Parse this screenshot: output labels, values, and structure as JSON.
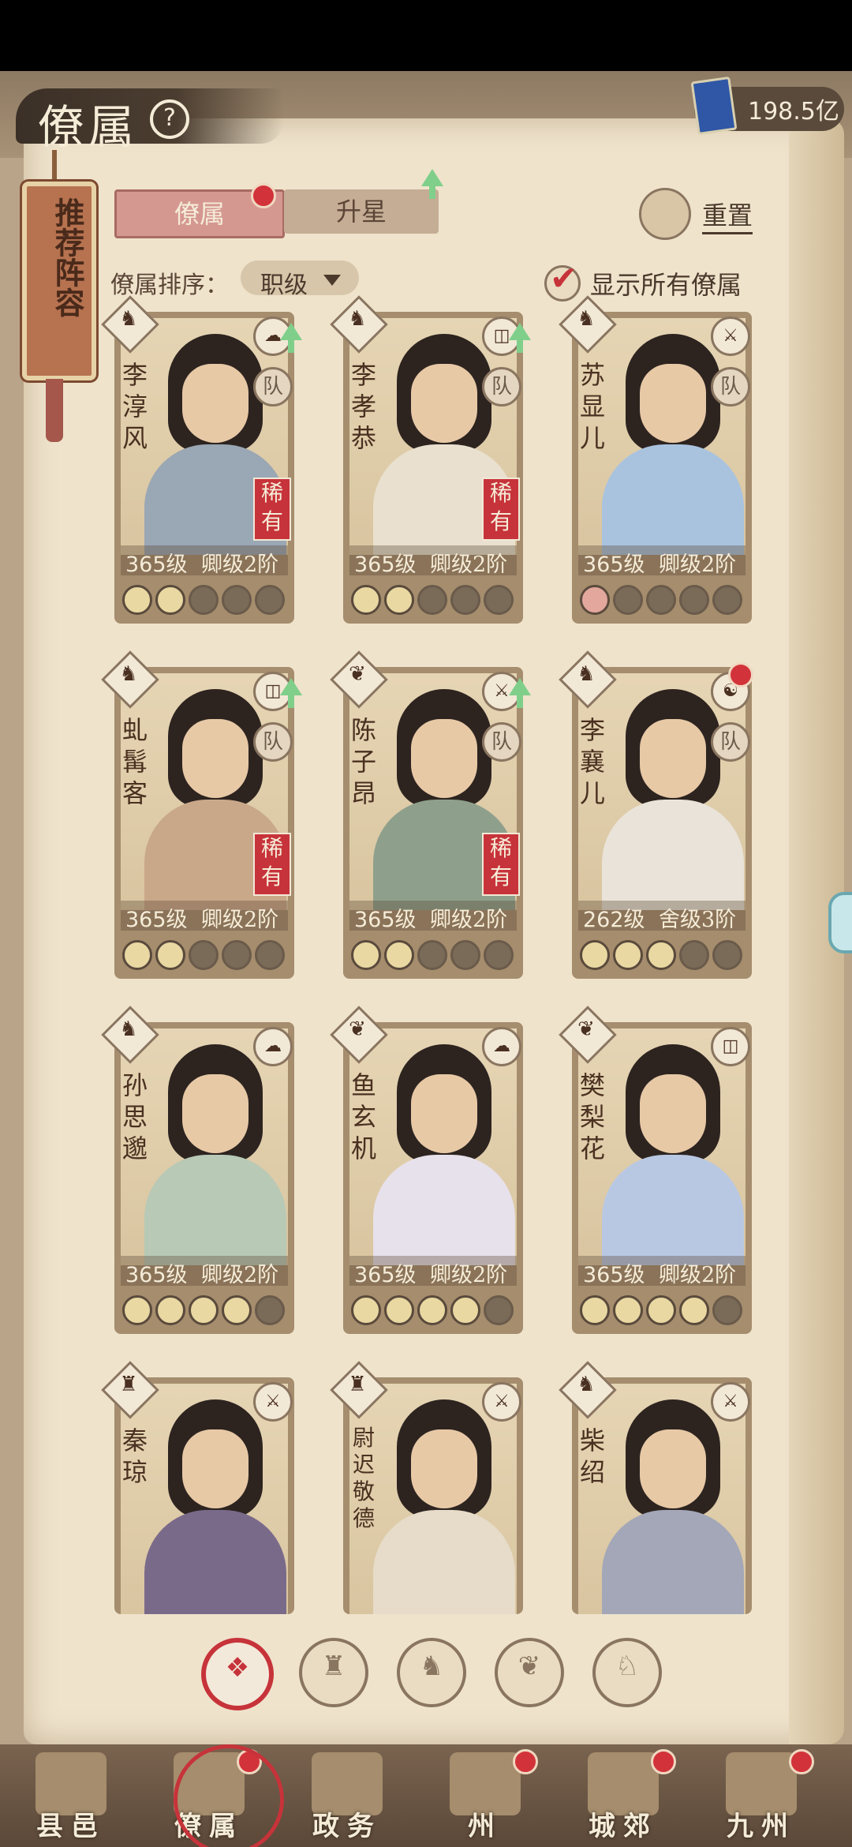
{
  "header": {
    "title": "僚属",
    "help_icon": "question-circle-icon",
    "currency": {
      "value": "198.5亿",
      "icon": "book-currency-icon"
    }
  },
  "side_banner": {
    "label": "推荐阵容"
  },
  "tabs": [
    {
      "label": "僚属",
      "active": true,
      "badge": true
    },
    {
      "label": "升星",
      "active": false,
      "badge": false
    }
  ],
  "reset": {
    "label": "重置"
  },
  "sort": {
    "label": "僚属排序：",
    "value": "职级"
  },
  "show_all": {
    "label": "显示所有僚属",
    "checked": true
  },
  "cards": [
    {
      "name": "李淳风",
      "level": "365级",
      "rank": "卿级2阶",
      "rare": "稀有",
      "team": "队",
      "stars": [
        "on",
        "on",
        "off",
        "off",
        "off"
      ],
      "upgrade": true,
      "badge": false,
      "skill": "☁",
      "cls": "♞",
      "robe": "#9aa7b4"
    },
    {
      "name": "李孝恭",
      "level": "365级",
      "rank": "卿级2阶",
      "rare": "稀有",
      "team": "队",
      "stars": [
        "on",
        "on",
        "off",
        "off",
        "off"
      ],
      "upgrade": true,
      "badge": false,
      "skill": "◫",
      "cls": "♞",
      "robe": "#e9e0cf"
    },
    {
      "name": "苏显儿",
      "level": "365级",
      "rank": "卿级2阶",
      "rare": "",
      "team": "队",
      "stars": [
        "red",
        "off",
        "off",
        "off",
        "off"
      ],
      "upgrade": false,
      "badge": false,
      "skill": "⚔",
      "cls": "♞",
      "robe": "#a9c3df"
    },
    {
      "name": "虬髯客",
      "level": "365级",
      "rank": "卿级2阶",
      "rare": "稀有",
      "team": "队",
      "stars": [
        "on",
        "on",
        "off",
        "off",
        "off"
      ],
      "upgrade": true,
      "badge": false,
      "skill": "◫",
      "cls": "♞",
      "robe": "#c9a88a"
    },
    {
      "name": "陈子昂",
      "level": "365级",
      "rank": "卿级2阶",
      "rare": "稀有",
      "team": "队",
      "stars": [
        "on",
        "on",
        "off",
        "off",
        "off"
      ],
      "upgrade": true,
      "badge": false,
      "skill": "⚔",
      "cls": "❦",
      "robe": "#8ea08c"
    },
    {
      "name": "李襄儿",
      "level": "262级",
      "rank": "舍级3阶",
      "rare": "",
      "team": "队",
      "stars": [
        "on",
        "on",
        "on",
        "off",
        "off"
      ],
      "upgrade": false,
      "badge": true,
      "skill": "☯",
      "cls": "♞",
      "robe": "#e9e3d9"
    },
    {
      "name": "孙思邈",
      "level": "365级",
      "rank": "卿级2阶",
      "rare": "",
      "team": "",
      "stars": [
        "on",
        "on",
        "on",
        "on",
        "off"
      ],
      "upgrade": false,
      "badge": false,
      "skill": "☁",
      "cls": "♞",
      "robe": "#b8c9b6"
    },
    {
      "name": "鱼玄机",
      "level": "365级",
      "rank": "卿级2阶",
      "rare": "",
      "team": "",
      "stars": [
        "on",
        "on",
        "on",
        "on",
        "off"
      ],
      "upgrade": false,
      "badge": false,
      "skill": "☁",
      "cls": "❦",
      "robe": "#e6e1ea"
    },
    {
      "name": "樊梨花",
      "level": "365级",
      "rank": "卿级2阶",
      "rare": "",
      "team": "",
      "stars": [
        "on",
        "on",
        "on",
        "on",
        "off"
      ],
      "upgrade": false,
      "badge": false,
      "skill": "◫",
      "cls": "❦",
      "robe": "#b9c8e2"
    },
    {
      "name": "秦琼",
      "level": "",
      "rank": "",
      "rare": "",
      "team": "",
      "stars": [],
      "upgrade": false,
      "badge": false,
      "skill": "⚔",
      "cls": "♜",
      "robe": "#7a6a8a"
    },
    {
      "name": "尉迟敬德",
      "level": "",
      "rank": "",
      "rare": "",
      "team": "",
      "stars": [],
      "upgrade": false,
      "badge": false,
      "skill": "⚔",
      "cls": "♜",
      "robe": "#e7dcc9"
    },
    {
      "name": "柴绍",
      "level": "",
      "rank": "",
      "rare": "",
      "team": "",
      "stars": [],
      "upgrade": false,
      "badge": false,
      "skill": "⚔",
      "cls": "♞",
      "robe": "#a3a7b8"
    }
  ],
  "filters": [
    {
      "icon": "all-diamond-icon",
      "sym": "❖",
      "active": true
    },
    {
      "icon": "scholar-hat-icon",
      "sym": "♜",
      "active": false
    },
    {
      "icon": "beast-icon",
      "sym": "♞",
      "active": false
    },
    {
      "icon": "fan-icon",
      "sym": "❦",
      "active": false
    },
    {
      "icon": "horse-icon",
      "sym": "♘",
      "active": false
    }
  ],
  "nav": [
    {
      "label": "县邑",
      "icon": "county-gate-icon",
      "badge": false,
      "selected": false
    },
    {
      "label": "僚属",
      "icon": "retainers-icon",
      "badge": true,
      "selected": true
    },
    {
      "label": "政务",
      "icon": "affairs-icon",
      "badge": false,
      "selected": false
    },
    {
      "label": "州",
      "icon": "province-icon",
      "badge": true,
      "selected": false
    },
    {
      "label": "城郊",
      "icon": "suburb-icon",
      "badge": true,
      "selected": false
    },
    {
      "label": "九州",
      "icon": "world-map-icon",
      "badge": true,
      "selected": false
    }
  ],
  "colors": {
    "accent_red": "#c7333a",
    "paper": "#efe3cc",
    "upgrade_green": "#7fcf8a"
  }
}
